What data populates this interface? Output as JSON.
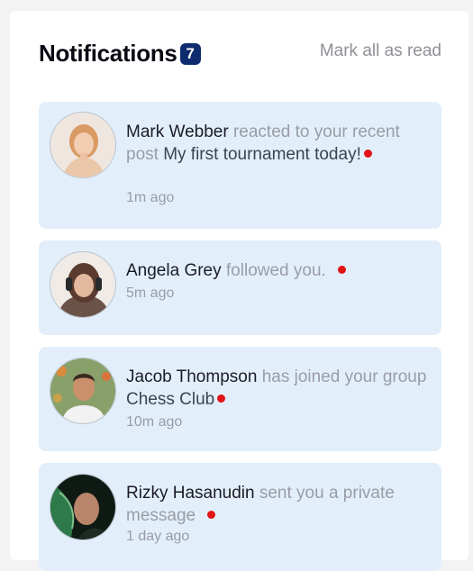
{
  "header": {
    "title": "Notifications",
    "unread_count": "7",
    "mark_all_label": "Mark all as read"
  },
  "notifications": [
    {
      "actor": "Mark Webber",
      "action": "reacted to your recent post",
      "object": "My first tournament today!",
      "time": "1m ago",
      "unread": true
    },
    {
      "actor": "Angela Grey",
      "action": "followed you.",
      "object": "",
      "time": "5m ago",
      "unread": true
    },
    {
      "actor": "Jacob Thompson",
      "action": "has joined your group",
      "object": "Chess Club",
      "time": "10m ago",
      "unread": true
    },
    {
      "actor": "Rizky Hasanudin",
      "action": "sent you a private message",
      "object": "",
      "time": "1 day ago",
      "unread": true
    }
  ],
  "colors": {
    "badge": "#0e2b6e",
    "card_background": "#e2effb",
    "unread_dot": "#e11515",
    "muted_text": "#9a9ca4"
  }
}
